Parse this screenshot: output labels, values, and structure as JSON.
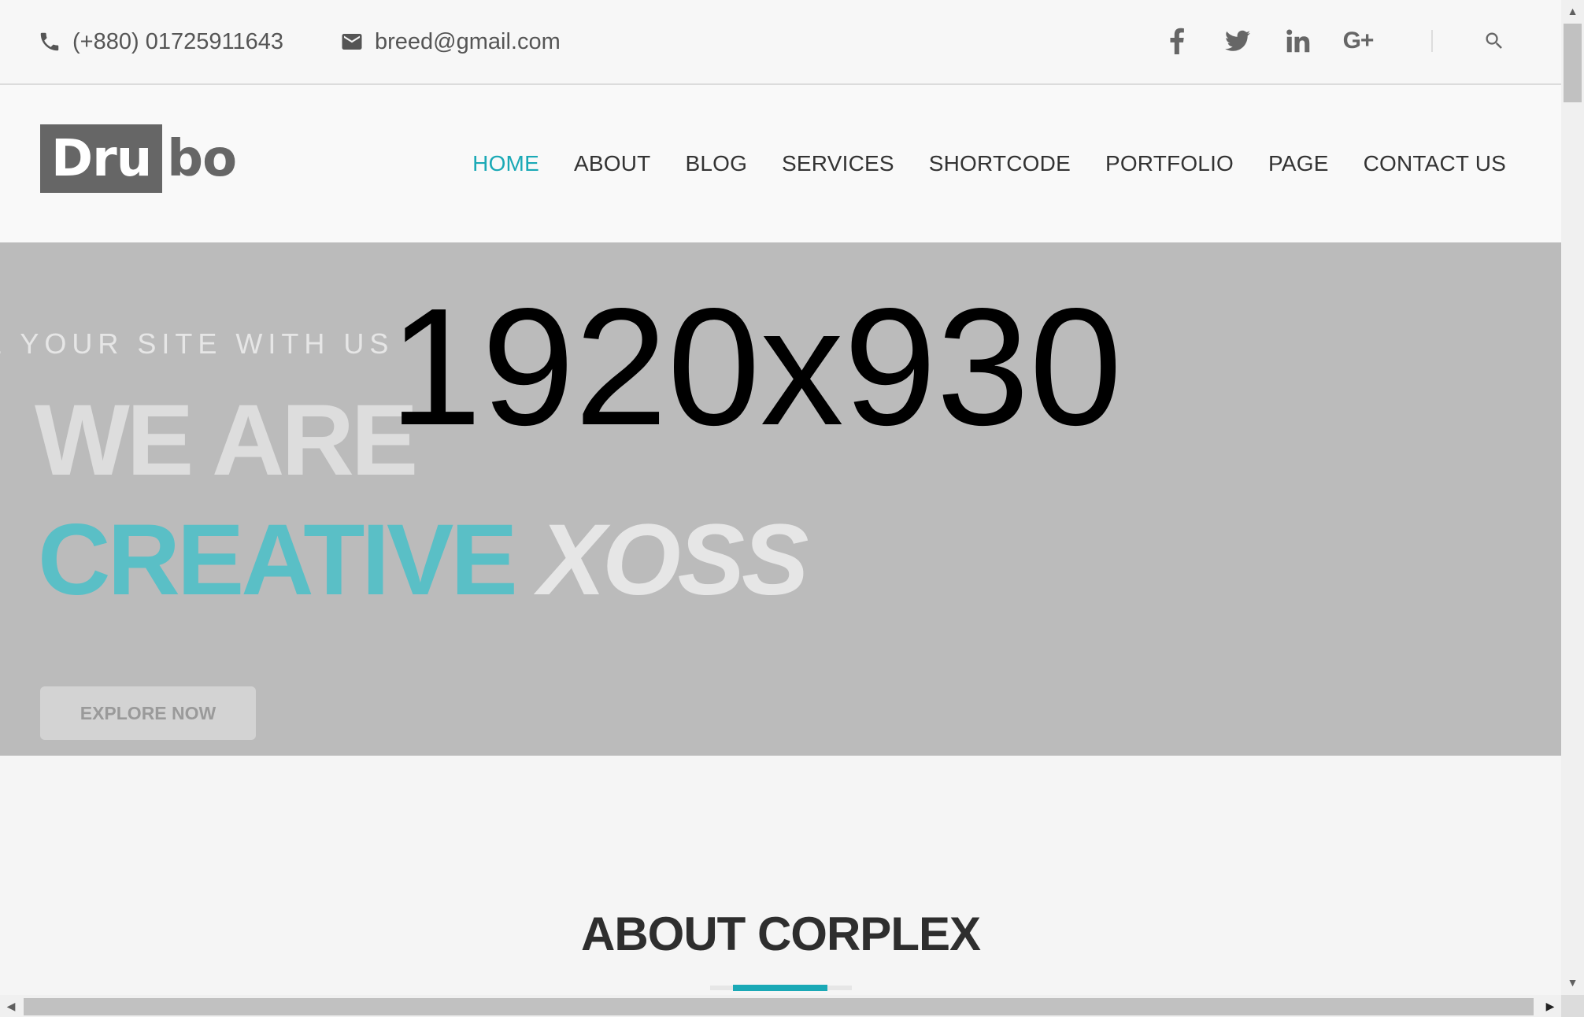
{
  "topbar": {
    "phone": "(+880) 01725911643",
    "email": "breed@gmail.com",
    "social_icons": [
      "facebook-icon",
      "twitter-icon",
      "linkedin-icon",
      "google-plus-icon"
    ],
    "search_icon": "search-icon"
  },
  "brand": {
    "logo_box": "Dru",
    "logo_rest": "bo"
  },
  "nav": {
    "items": [
      {
        "label": "HOME",
        "active": true
      },
      {
        "label": "ABOUT"
      },
      {
        "label": "BLOG"
      },
      {
        "label": "SERVICES"
      },
      {
        "label": "SHORTCODE"
      },
      {
        "label": "PORTFOLIO"
      },
      {
        "label": "PAGE"
      },
      {
        "label": "CONTACT US"
      }
    ]
  },
  "hero": {
    "tagline": "E YOUR SITE WITH US",
    "placeholder": "1920x930",
    "line1": "WE ARE",
    "line2_accent": "CREATIVE",
    "line2_rest": "XOSS",
    "cta": "EXPLORE NOW"
  },
  "about": {
    "title": "ABOUT CORPLEX"
  },
  "colors": {
    "accent": "#1aa9b6",
    "hero_bg": "#bbbbbb",
    "hero_accent": "#5abfc6"
  }
}
